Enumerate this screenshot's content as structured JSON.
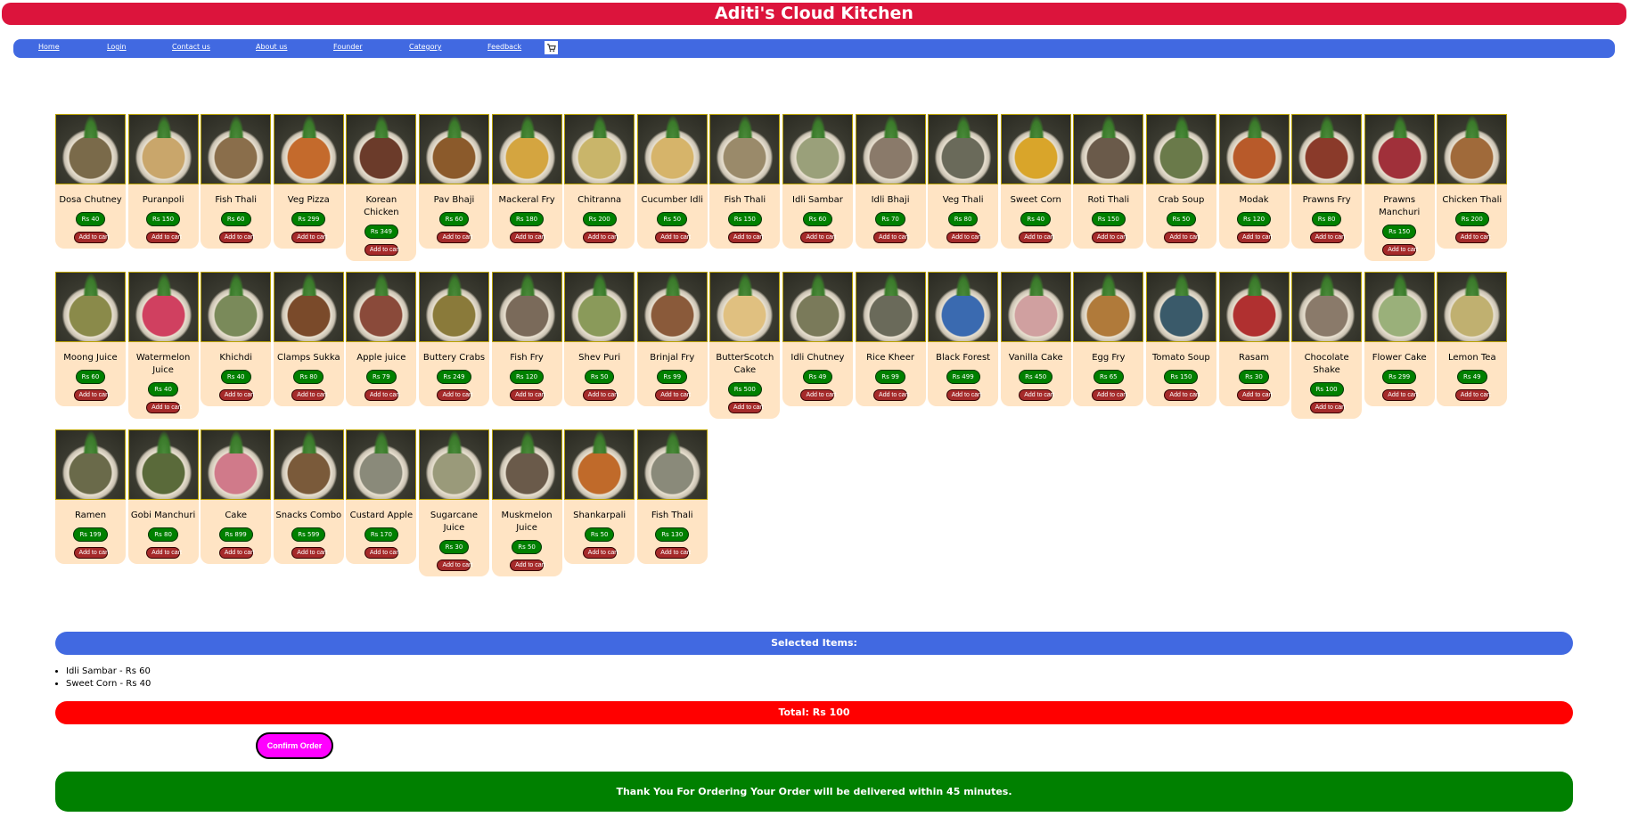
{
  "header": {
    "title": "Aditi's Cloud Kitchen"
  },
  "nav": {
    "items": [
      "Home",
      "Login",
      "Contact us",
      "About us",
      "Founder",
      "Category",
      "Feedback"
    ],
    "cart_icon": "cart-icon"
  },
  "menu": {
    "add_label": "Add to cart",
    "price_prefix": "Rs ",
    "rows": [
      [
        {
          "name": "Dosa Chutney",
          "price": 40,
          "color": "#7a6a4a"
        },
        {
          "name": "Puranpoli",
          "price": 150,
          "color": "#c9a66b"
        },
        {
          "name": "Fish Thali",
          "price": 60,
          "color": "#8a6e4b"
        },
        {
          "name": "Veg Pizza",
          "price": 299,
          "color": "#c46a2c"
        },
        {
          "name": "Korean Chicken",
          "price": 349,
          "color": "#6b3b2a"
        },
        {
          "name": "Pav Bhaji",
          "price": 60,
          "color": "#8b5a2b"
        },
        {
          "name": "Mackeral Fry",
          "price": 180,
          "color": "#d4a540"
        },
        {
          "name": "Chitranna",
          "price": 200,
          "color": "#c9b56a"
        },
        {
          "name": "Cucumber Idli",
          "price": 50,
          "color": "#d6b46a"
        },
        {
          "name": "Fish Thali",
          "price": 150,
          "color": "#9a8a6a"
        },
        {
          "name": "Idli Sambar",
          "price": 60,
          "color": "#9aa07a"
        },
        {
          "name": "Idli Bhaji",
          "price": 70,
          "color": "#8a7a6a"
        },
        {
          "name": "Veg Thali",
          "price": 80,
          "color": "#6a6a5a"
        },
        {
          "name": "Sweet Corn",
          "price": 40,
          "color": "#d9a52a"
        },
        {
          "name": "Roti Thali",
          "price": 150,
          "color": "#6a5a4a"
        },
        {
          "name": "Crab Soup",
          "price": 50,
          "color": "#6a7a4a"
        },
        {
          "name": "Modak",
          "price": 120,
          "color": "#b85a2a"
        },
        {
          "name": "Prawns Fry",
          "price": 80,
          "color": "#8a3a2a"
        },
        {
          "name": "Prawns Manchuri",
          "price": 150,
          "color": "#a0303a"
        },
        {
          "name": "Chicken Thali",
          "price": 200,
          "color": "#a06a3a"
        }
      ],
      [
        {
          "name": "Moong Juice",
          "price": 60,
          "color": "#8a8a4a"
        },
        {
          "name": "Watermelon Juice",
          "price": 40,
          "color": "#d04060"
        },
        {
          "name": "Khichdi",
          "price": 40,
          "color": "#7a8a5a"
        },
        {
          "name": "Clamps Sukka",
          "price": 80,
          "color": "#7a4a2a"
        },
        {
          "name": "Apple juice",
          "price": 79,
          "color": "#8a4a3a"
        },
        {
          "name": "Buttery Crabs",
          "price": 249,
          "color": "#8a7a3a"
        },
        {
          "name": "Fish Fry",
          "price": 120,
          "color": "#7a6a5a"
        },
        {
          "name": "Shev Puri",
          "price": 50,
          "color": "#8a9a5a"
        },
        {
          "name": "Brinjal Fry",
          "price": 99,
          "color": "#8a5a3a"
        },
        {
          "name": "ButterScotch Cake",
          "price": 500,
          "color": "#e0c080"
        },
        {
          "name": "Idli Chutney",
          "price": 49,
          "color": "#7a7a5a"
        },
        {
          "name": "Rice Kheer",
          "price": 99,
          "color": "#6a6a5a"
        },
        {
          "name": "Black Forest",
          "price": 499,
          "color": "#3a6ab0"
        },
        {
          "name": "Vanilla Cake",
          "price": 450,
          "color": "#d0a0a0"
        },
        {
          "name": "Egg Fry",
          "price": 65,
          "color": "#b07a3a"
        },
        {
          "name": "Tomato Soup",
          "price": 150,
          "color": "#3a5a6a"
        },
        {
          "name": "Rasam",
          "price": 30,
          "color": "#b03030"
        },
        {
          "name": "Chocolate Shake",
          "price": 100,
          "color": "#8a7a6a"
        },
        {
          "name": "Flower Cake",
          "price": 299,
          "color": "#9ab07a"
        },
        {
          "name": "Lemon Tea",
          "price": 49,
          "color": "#c0b070"
        }
      ],
      [
        {
          "name": "Ramen",
          "price": 199,
          "color": "#6a6a4a"
        },
        {
          "name": "Gobi Manchuri",
          "price": 80,
          "color": "#5a6a3a"
        },
        {
          "name": "Cake",
          "price": 899,
          "color": "#d07a8a"
        },
        {
          "name": "Snacks Combo",
          "price": 599,
          "color": "#7a5a3a"
        },
        {
          "name": "Custard Apple",
          "price": 170,
          "color": "#8a8a7a"
        },
        {
          "name": "Sugarcane Juice",
          "price": 30,
          "color": "#9a9a7a"
        },
        {
          "name": "Muskmelon Juice",
          "price": 50,
          "color": "#6a5a4a"
        },
        {
          "name": "Shankarpali",
          "price": 50,
          "color": "#c06a2a"
        },
        {
          "name": "Fish Thali",
          "price": 130,
          "color": "#8a8a7a"
        }
      ]
    ]
  },
  "selected": {
    "heading": "Selected Items:",
    "items": [
      "Idli Sambar - Rs 60",
      "Sweet Corn - Rs 40"
    ]
  },
  "total": {
    "label": "Total: Rs 100"
  },
  "confirm": {
    "label": "Confirm Order"
  },
  "thanks": {
    "message": "Thank You For Ordering Your Order will be delivered within 45 minutes."
  },
  "colors": {
    "title_bar": "#dc143c",
    "nav_bar": "#4169e1",
    "card_bg": "#ffe4c4",
    "price_badge": "#008000",
    "add_button": "#a52a2a",
    "total_bar": "#ff0000",
    "confirm_button": "#ff00ff",
    "thanks_bar": "#008000"
  }
}
